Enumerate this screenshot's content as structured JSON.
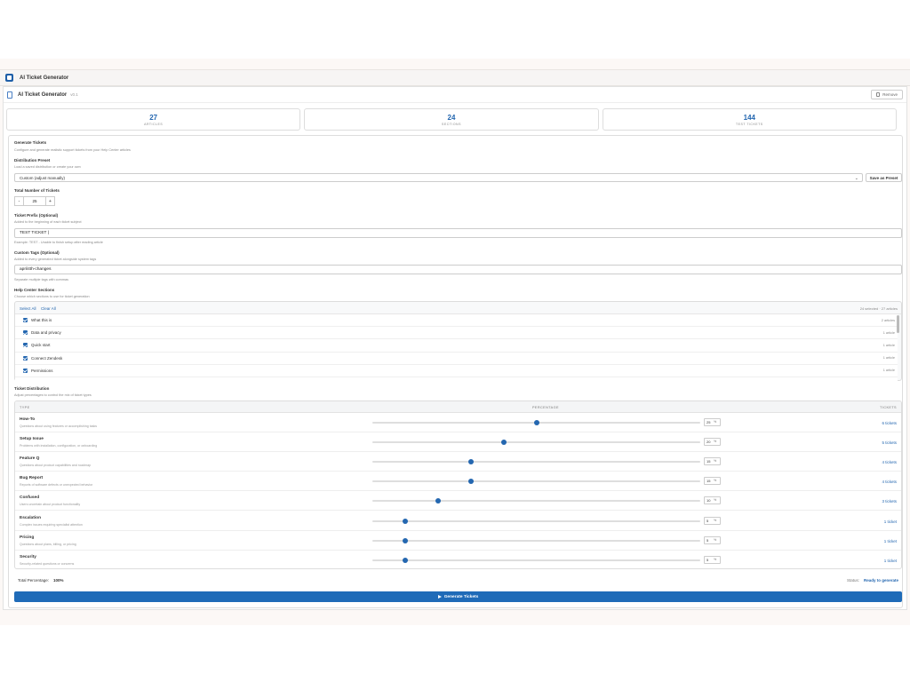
{
  "window": {
    "title": "AI Ticket Generator"
  },
  "panel": {
    "title": "AI Ticket Generator",
    "version": "v0.1",
    "remove_label": "Remove"
  },
  "stats": [
    {
      "value": "27",
      "label": "ARTICLES"
    },
    {
      "value": "24",
      "label": "SECTIONS"
    },
    {
      "value": "144",
      "label": "TEST TICKETS"
    }
  ],
  "generate": {
    "title": "Generate Tickets",
    "subtitle": "Configure and generate realistic support tickets from your Help Center articles"
  },
  "preset": {
    "label": "Distribution Preset",
    "hint": "Load a saved distribution or create your own",
    "selected": "Custom (adjust manually)",
    "save_label": "Save as Preset"
  },
  "total": {
    "label": "Total Number of Tickets",
    "value": "25",
    "minus": "-",
    "plus": "+"
  },
  "prefix": {
    "label": "Ticket Prefix (Optional)",
    "hint": "Added to the beginning of each ticket subject",
    "value": "TEST TICKET |",
    "example": "Example: TEST - Unable to finish setup after reading article"
  },
  "tags": {
    "label": "Custom Tags (Optional)",
    "hint": "Added to every generated ticket alongside system tags",
    "value": "april4th-changes",
    "example": "Separate multiple tags with commas"
  },
  "sections": {
    "label": "Help Center Sections",
    "hint": "Choose which sections to use for ticket generation",
    "select_all": "Select All",
    "clear_all": "Clear All",
    "count": "24 selected · 27 articles",
    "items": [
      {
        "name": "What this is",
        "articles": "2 articles"
      },
      {
        "name": "Data and privacy",
        "articles": "1 article"
      },
      {
        "name": "Quick start",
        "articles": "1 article"
      },
      {
        "name": "Connect Zendesk",
        "articles": "1 article"
      },
      {
        "name": "Permissions",
        "articles": "1 article"
      }
    ]
  },
  "distribution": {
    "label": "Ticket Distribution",
    "hint": "Adjust percentages to control the mix of ticket types",
    "columns": {
      "type": "TYPE",
      "percentage": "PERCENTAGE",
      "tickets": "TICKETS"
    },
    "rows": [
      {
        "name": "How-To",
        "desc": "Questions about using features or accomplishing tasks",
        "percent": 25,
        "percent_text": "25",
        "tickets": "6 tickets"
      },
      {
        "name": "Setup Issue",
        "desc": "Problems with installation, configuration, or onboarding",
        "percent": 20,
        "percent_text": "20",
        "tickets": "5 tickets"
      },
      {
        "name": "Feature Q",
        "desc": "Questions about product capabilities and roadmap",
        "percent": 15,
        "percent_text": "15",
        "tickets": "4 tickets"
      },
      {
        "name": "Bug Report",
        "desc": "Reports of software defects or unexpected behavior",
        "percent": 15,
        "percent_text": "15",
        "tickets": "4 tickets"
      },
      {
        "name": "Confused",
        "desc": "Users uncertain about product functionality",
        "percent": 10,
        "percent_text": "10",
        "tickets": "3 tickets"
      },
      {
        "name": "Escalation",
        "desc": "Complex issues requiring specialist attention",
        "percent": 5,
        "percent_text": "5",
        "tickets": "1 ticket"
      },
      {
        "name": "Pricing",
        "desc": "Questions about plans, billing, or pricing",
        "percent": 5,
        "percent_text": "5",
        "tickets": "1 ticket"
      },
      {
        "name": "Security",
        "desc": "Security-related questions or concerns",
        "percent": 5,
        "percent_text": "5",
        "tickets": "1 ticket"
      }
    ]
  },
  "footer": {
    "total_label": "Total Percentage:",
    "total_value": "100%",
    "status_label": "Status:",
    "status_value": "Ready to generate",
    "generate_label": "Generate Tickets"
  },
  "colors": {
    "accent": "#2467b0",
    "button": "#1f6bb8"
  },
  "icons": {
    "app": "app-logo-icon",
    "doc": "document-icon",
    "remove": "trash-icon",
    "dropdown": "chevron-down-icon",
    "generate": "play-icon"
  }
}
